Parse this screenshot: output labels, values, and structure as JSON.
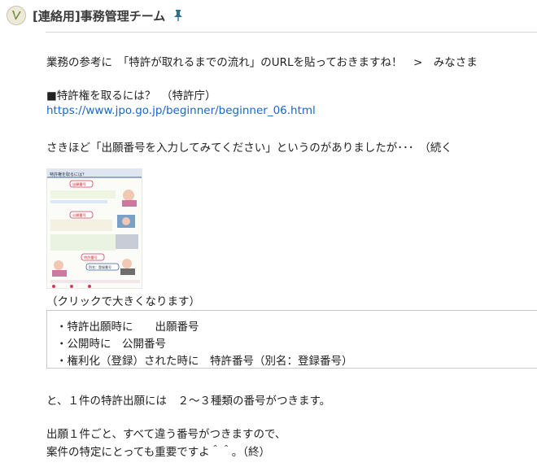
{
  "header": {
    "title": "[連絡用]事務管理チーム",
    "avatar_icon": "pen-avatar-icon",
    "pin_icon": "pin-icon"
  },
  "message": {
    "intro": "業務の参考に　「特許が取れるまでの流れ」のURLを貼っておきますね！　>　みなさま",
    "section_heading": "■特許権を取るには？　（特許庁）",
    "link": "https://www.jpo.go.jp/beginner/beginner_06.html",
    "continuation": "さきほど「出願番号を入力してみてください」というのがありましたが･･･　（続く",
    "thumbnail": {
      "heading": "特許権を取るには？",
      "labels": [
        "出願番号",
        "公開番号",
        "特許番号",
        "別名：登録番号"
      ]
    },
    "caption": "（クリックで大きくなります）",
    "quote_items": [
      "・特許出願時に　　出願番号",
      "・公開時に　公開番号",
      "・権利化（登録）された時に　特許番号（別名：登録番号）"
    ],
    "summary": "と、１件の特許出願には　２～３種類の番号がつきます。",
    "closing_1": "出願１件ごと、すべて違う番号がつきますので、",
    "closing_2": "案件の特定にとっても重要ですよ＾＾。（終）"
  },
  "colors": {
    "link": "#1a66cc",
    "pin": "#2f6f8f",
    "box_border": "#c8c8c8"
  }
}
